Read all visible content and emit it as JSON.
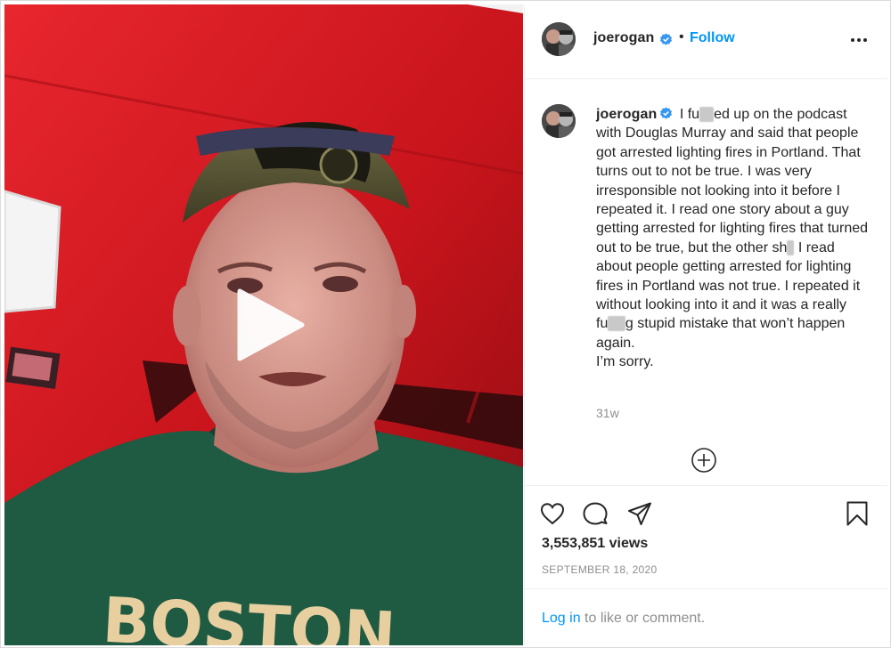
{
  "post": {
    "author": {
      "username": "joerogan",
      "verified": true,
      "follow_label": "Follow",
      "separator": "•"
    },
    "caption": {
      "segments": [
        {
          "text": " I fu",
          "blur": false
        },
        {
          "text": "ck",
          "blur": true
        },
        {
          "text": "ed up on the podcast with Douglas Murray and said that people got arrested lighting fires in Portland. That turns out to not be true. I was very irresponsible not looking into it before I repeated it. I read one story about a guy getting arrested for lighting fires that turned out to be true, but the other sh",
          "blur": false
        },
        {
          "text": "it",
          "blur": true
        },
        {
          "text": " I read about people getting arrested for lighting fires in Portland was not true. I repeated it without looking into it and it was a really fu",
          "blur": false
        },
        {
          "text": "cki",
          "blur": true
        },
        {
          "text": "g stupid mistake that won’t happen again.",
          "blur": false
        }
      ],
      "second_line": "I’m sorry."
    },
    "time_ago": "31w",
    "views": "3,553,851 views",
    "date": "SEPTEMBER 18, 2020",
    "login_prompt": {
      "link": "Log in",
      "rest": " to like or comment."
    }
  },
  "icons": {
    "avatar": "avatar-image",
    "verified": "verified-badge-icon",
    "more": "more-options-icon",
    "play": "play-icon",
    "add_comment": "plus-circle-icon",
    "like": "heart-icon",
    "comment": "comment-icon",
    "share": "share-icon",
    "save": "bookmark-icon"
  },
  "colors": {
    "accent": "#0095f6",
    "text": "#262626",
    "muted": "#8e8e8e",
    "border": "#efefef",
    "video_bg": "#c0181f",
    "verified": "#3897f0"
  }
}
